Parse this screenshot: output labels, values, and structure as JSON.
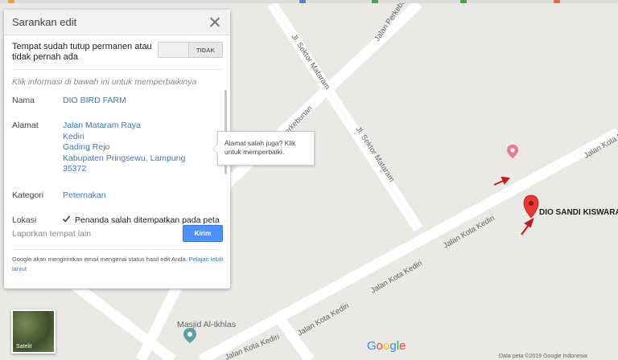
{
  "panel": {
    "title": "Sarankan edit",
    "closed_question": "Tempat sudah tutup permanen atau tidak pernah ada",
    "closed_toggle_label": "TIDAK",
    "hint": "Klik informasi di bawah ini untuk memperbaikinya",
    "name_label": "Nama",
    "name_value": "DIO BIRD FARM",
    "address_label": "Alamat",
    "address_lines": [
      "Jalan Mataram Raya",
      "Kediri",
      "Gading Rejo",
      "Kabupaten Pringsewu, Lampung",
      "35372"
    ],
    "category_label": "Kategori",
    "category_value": "Peternakan",
    "location_label": "Lokasi",
    "location_checkbox_text": "Penanda salah ditempatkan pada peta",
    "report_link": "Laporkan tempat lain",
    "send_button": "Kirim",
    "footnote_text": "Google akan mengirimkan email mengenai status hasil edit Anda.",
    "footnote_link": "Pelajari lebih lanjut"
  },
  "tooltip": {
    "text": "Alamat salah juga? Klik untuk memperbaiki."
  },
  "map": {
    "roads": {
      "sektor_mataram_1": "Jl. Sektor Mataram",
      "sektor_mataram_2": "Jl. Sektor Mataram",
      "perkebunan_1": "Jalan Perkebunan",
      "perkebunan_2": "Perkebunan",
      "kota_kediri_1": "Jalan Kota Kediri",
      "kota_kediri_2": "Jalan Kota Kediri",
      "kota_kediri_3": "Jalan Kota Kediri",
      "kota_kediri_4": "Jalan Kota Kediri",
      "kota_kediri_5": "Jalan Kota Kediri"
    },
    "poi_mosque": "Masjid Al-Ikhlas",
    "marker_label": "DIO SANDI KISWARA",
    "satellite_label": "Satelit",
    "google_logo": [
      "G",
      "o",
      "o",
      "g",
      "l",
      "e"
    ],
    "google_colors": [
      "#4285f4",
      "#ea4335",
      "#fbbc05",
      "#4285f4",
      "#34a853",
      "#ea4335"
    ],
    "copyright": "Data peta ©2019 Google  Indonesia"
  },
  "colors": {
    "accent": "#4d90fe",
    "link": "#3b79c2",
    "marker": "#e53935",
    "poi_pink": "#e67c9b",
    "poi_teal": "#5b9ea6"
  }
}
